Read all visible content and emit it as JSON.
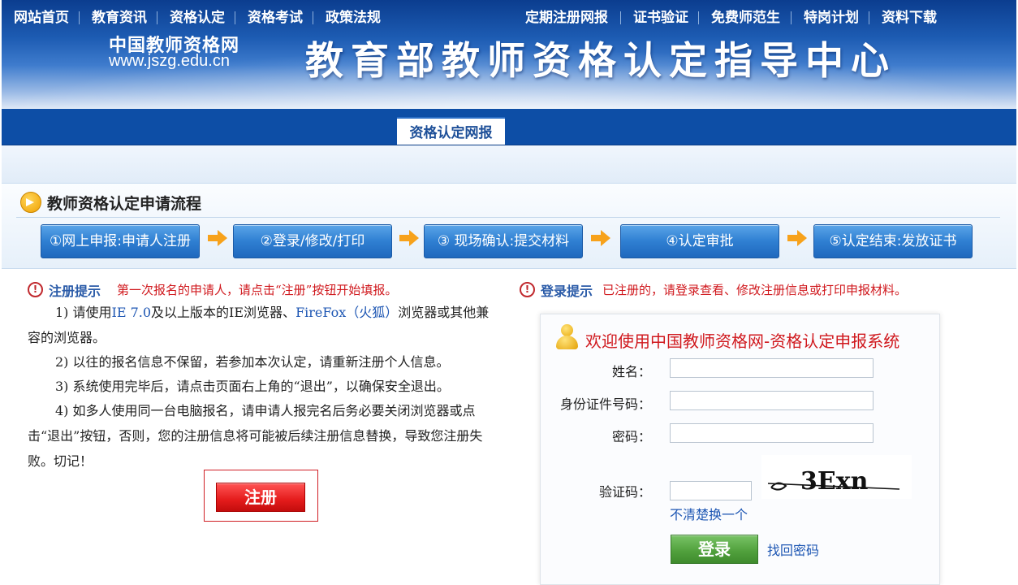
{
  "header": {
    "site_name": "中国教师资格网",
    "site_url": "www.jszg.edu.cn",
    "title": "教育部教师资格认定指导中心"
  },
  "nav": {
    "items": [
      "网站首页",
      "教育资讯",
      "资格认定",
      "资格考试",
      "政策法规",
      "资格认定网报",
      "定期注册网报",
      "证书验证",
      "免费师范生",
      "特岗计划",
      "资料下载"
    ],
    "active_index": 5
  },
  "process": {
    "title": "教师资格认定申请流程",
    "steps": [
      "①网上申报:申请人注册",
      "②登录/修改/打印",
      "③ 现场确认:提交材料",
      "④认定审批",
      "⑤认定结束:发放证书"
    ]
  },
  "register_notice": {
    "label": "注册提示",
    "text": "第一次报名的申请人，请点击“注册”按钮开始填报。",
    "item1_a": "1) 请使用",
    "item1_ie": "IE 7.0",
    "item1_b": "及以上版本的IE浏览器、",
    "item1_ff": "FireFox（火狐）",
    "item1_c": "浏览器或其他兼容的浏览器。",
    "item2": "2) 以往的报名信息不保留，若参加本次认定，请重新注册个人信息。",
    "item3": "3) 系统使用完毕后，请点击页面右上角的“退出”，以确保安全退出。",
    "item4": "4) 如多人使用同一台电脑报名，请申请人报完名后务必要关闭浏览器或点击“退出”按钮，否则，您的注册信息将可能被后续注册信息替换，导致您注册失败。切记！",
    "register_button": "注册"
  },
  "login": {
    "tip_label": "登录提示",
    "tip_text": "已注册的，请登录查看、修改注册信息或打印申报材料。",
    "welcome": "欢迎使用中国教师资格网-资格认定申报系统",
    "name_label": "姓名：",
    "id_label": "身份证件号码：",
    "password_label": "密码：",
    "captcha_label": "验证码：",
    "captcha_text": "3Exn",
    "refresh": "不清楚换一个",
    "login_button": "登录",
    "forgot": "找回密码"
  },
  "colors": {
    "nav_bg": "#0d4ea6",
    "step_blue": "#2f7fd2",
    "arrow_orange": "#f7a21b",
    "warning_red": "#d0191e",
    "link_blue": "#1d56b3",
    "login_green": "#4f9f3b"
  }
}
